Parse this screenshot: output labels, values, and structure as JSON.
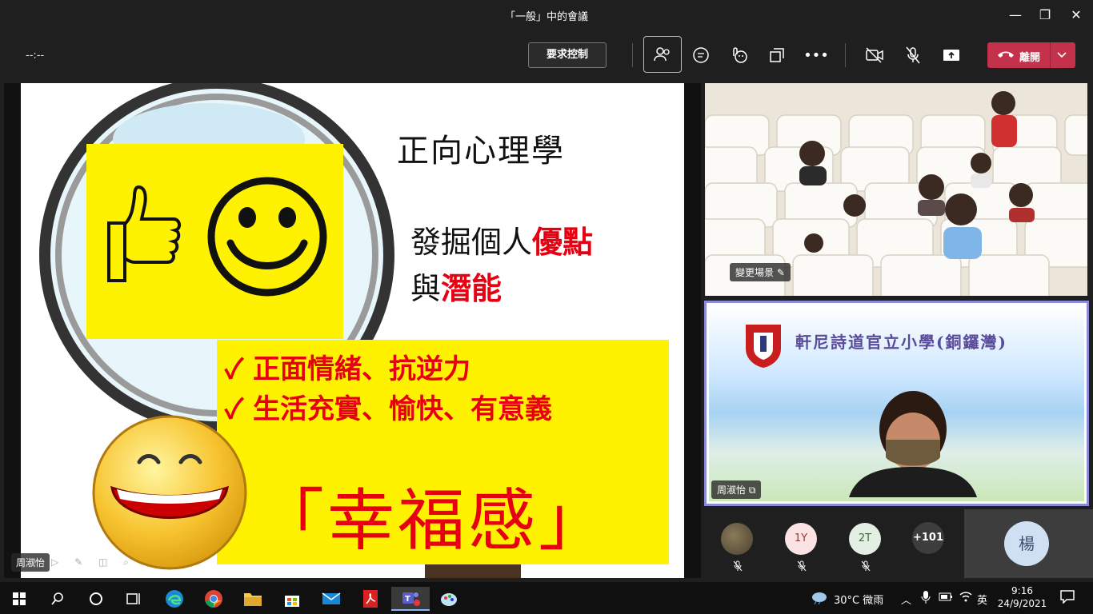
{
  "window": {
    "title": "「一般」中的會議"
  },
  "toolbar": {
    "timer": "--:--",
    "request_control": "要求控制",
    "leave_label": "離開"
  },
  "slide": {
    "title": "正向心理學",
    "line1_prefix": "發掘個人",
    "line1_highlight": "優點",
    "line2_prefix": "與",
    "line2_highlight": "潛能",
    "check1": "✓ 正面情緒、抗逆力",
    "check2": "✓ 生活充實、愉快、有意義",
    "happiness": "「幸福感」",
    "presenter": "周淑怡"
  },
  "videos": {
    "room_tag": "變更場景",
    "school_name": "軒尼詩道官立小學(銅鑼灣)",
    "speaker_name": "周淑怡"
  },
  "roster": {
    "p2_initials": "1Y",
    "p3_initials": "2T",
    "more": "+101",
    "big_initial": "楊"
  },
  "taskbar": {
    "weather": "30°C 微雨",
    "ime": "英",
    "time": "9:16",
    "date": "24/9/2021"
  },
  "colors": {
    "leave": "#c4314b",
    "slide_red": "#e60012",
    "slide_yellow": "#fff200",
    "active_border": "#8b8bd8"
  }
}
